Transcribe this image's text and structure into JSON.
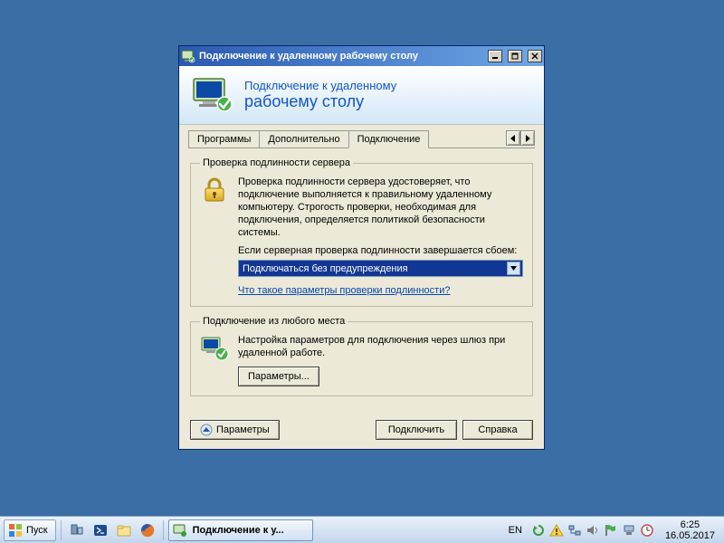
{
  "window": {
    "title": "Подключение к удаленному рабочему столу",
    "header_line1": "Подключение к удаленному",
    "header_line2": "рабочему столу"
  },
  "tabs": {
    "programs": "Программы",
    "advanced": "Дополнительно",
    "connection": "Подключение"
  },
  "group1": {
    "legend": "Проверка подлинности сервера",
    "desc": "Проверка подлинности сервера удостоверяет, что подключение выполняется к правильному удаленному компьютеру. Строгость проверки, необходимая для подключения, определяется политикой безопасности системы.",
    "prompt": "Если серверная проверка подлинности завершается сбоем:",
    "dropdown_value": "Подключаться без предупреждения",
    "link": "Что такое параметры проверки подлинности?"
  },
  "group2": {
    "legend": "Подключение из любого места",
    "desc": "Настройка параметров для подключения через шлюз при удаленной работе.",
    "settings_btn": "Параметры..."
  },
  "buttons": {
    "options": "Параметры",
    "connect": "Подключить",
    "help": "Справка"
  },
  "taskbar": {
    "start": "Пуск",
    "active_task": "Подключение к у...",
    "lang": "EN",
    "time": "6:25",
    "date": "16.05.2017"
  }
}
